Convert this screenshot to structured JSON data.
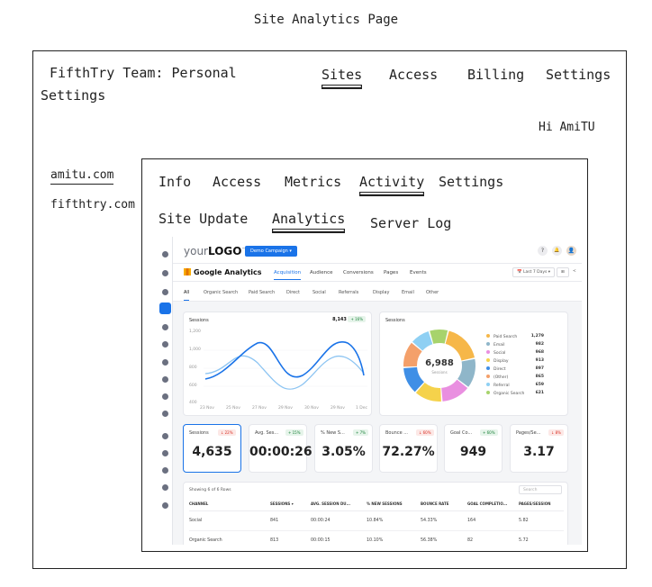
{
  "page_title": "Site Analytics Page",
  "topnav": {
    "team": "FifthTry Team: Personal",
    "team_settings": "Settings",
    "sites": "Sites",
    "access": "Access",
    "billing": "Billing",
    "settings": "Settings",
    "greeting": "Hi AmiTU"
  },
  "sites": [
    "amitu.com",
    "fifthtry.com"
  ],
  "site_tabs": {
    "info": "Info",
    "access": "Access",
    "metrics": "Metrics",
    "activity": "Activity",
    "settings": "Settings"
  },
  "sub_tabs": {
    "site_update": "Site Update",
    "analytics": "Analytics",
    "server_log": "Server Log"
  },
  "dashboard": {
    "logo_prefix": "your",
    "logo_main": "LOGO",
    "logo_tm": "™",
    "campaign": "Demo Campaign ▾",
    "header_icons": [
      "question-icon",
      "bell-icon",
      "user-avatar"
    ],
    "help_glyph": "?",
    "bell_glyph": "🔔",
    "avatar_glyph": "👤",
    "ga_title": "Google Analytics",
    "ga_tabs": [
      "Acquisition",
      "Audience",
      "Conversions",
      "Pages",
      "Events"
    ],
    "date_range": "📅 Last 7 Days ▾",
    "grid_btn": "⊞",
    "share_btn": "<",
    "filter_tabs": [
      "All",
      "Organic Search",
      "Paid Search",
      "Direct",
      "Social",
      "Referrals",
      "Display",
      "Email",
      "Other"
    ],
    "accent": "#1a73e8",
    "sessions_line": {
      "title": "Sessions",
      "total": "8,143",
      "change": "+ 16%",
      "y_ticks": [
        "1,200",
        "1,000",
        "800",
        "600",
        "400"
      ],
      "x_ticks": [
        "23 Nov",
        "25 Nov",
        "27 Nov",
        "29 Nov",
        "30 Nov",
        "29 Nov",
        "1 Dec"
      ]
    },
    "sessions_donut": {
      "title": "Sessions",
      "total": "6,988",
      "label": "Sessions",
      "segments": [
        {
          "name": "Paid Search",
          "value": "1,279",
          "color": "#f6b749"
        },
        {
          "name": "Email",
          "value": "982",
          "color": "#8fb6c9"
        },
        {
          "name": "Social",
          "value": "968",
          "color": "#e98fe0"
        },
        {
          "name": "Display",
          "value": "913",
          "color": "#f5d24b"
        },
        {
          "name": "Direct",
          "value": "897",
          "color": "#3f8fe6"
        },
        {
          "name": "(Other)",
          "value": "865",
          "color": "#f4a06a"
        },
        {
          "name": "Referral",
          "value": "659",
          "color": "#8fd0f3"
        },
        {
          "name": "Organic Search",
          "value": "621",
          "color": "#a7d36c"
        }
      ]
    },
    "kpis": [
      {
        "title": "Sessions",
        "change": "↓ 22%",
        "neg": true,
        "value": "4,635"
      },
      {
        "title": "Avg. Ses...",
        "change": "+ 15%",
        "neg": false,
        "value": "00:00:26"
      },
      {
        "title": "% New S...",
        "change": "+ 7%",
        "neg": false,
        "value": "3.05%"
      },
      {
        "title": "Bounce ...",
        "change": "↓ 60%",
        "neg": true,
        "value": "72.27%"
      },
      {
        "title": "Goal Co...",
        "change": "+ 60%",
        "neg": false,
        "value": "949"
      },
      {
        "title": "Pages/Se...",
        "change": "↓ 8%",
        "neg": true,
        "value": "3.17"
      }
    ],
    "table": {
      "showing": "Showing 6 of 6 Rows",
      "search_placeholder": "Search",
      "columns": [
        "CHANNEL",
        "SESSIONS ▾",
        "AVG. SESSION DU...",
        "% NEW SESSIONS",
        "BOUNCE RATE",
        "GOAL COMPLETIO...",
        "PAGES/SESSION"
      ],
      "rows": [
        [
          "Social",
          "841",
          "00:00:24",
          "10.84%",
          "54.33%",
          "164",
          "5.82"
        ],
        [
          "Organic Search",
          "813",
          "00:00:15",
          "10.10%",
          "56.38%",
          "82",
          "5.72"
        ]
      ]
    }
  }
}
